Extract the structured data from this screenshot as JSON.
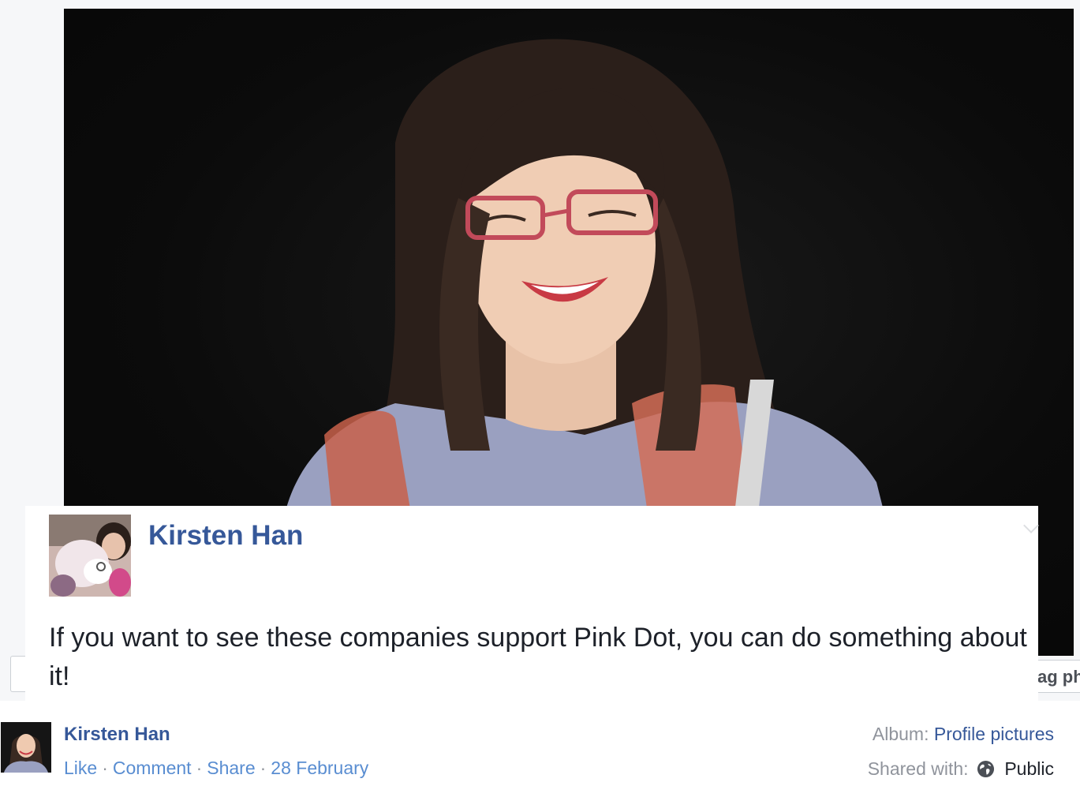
{
  "post": {
    "author": "Kirsten Han",
    "text": "If you want to see these companies support Pink Dot, you can do something about it!"
  },
  "underlying": {
    "right_stub_text": "ag ph"
  },
  "footer": {
    "author": "Kirsten Han",
    "actions": {
      "like": "Like",
      "comment": "Comment",
      "share": "Share",
      "date": "28 February",
      "separator": "·"
    },
    "album_label": "Album:",
    "album_value": "Profile pictures",
    "shared_label": "Shared with:",
    "shared_value": "Public",
    "shared_icon": "globe-icon"
  },
  "colors": {
    "link": "#365899",
    "muted": "#90949c",
    "text": "#1d2129",
    "photo_bg": "#0b0b0b"
  }
}
